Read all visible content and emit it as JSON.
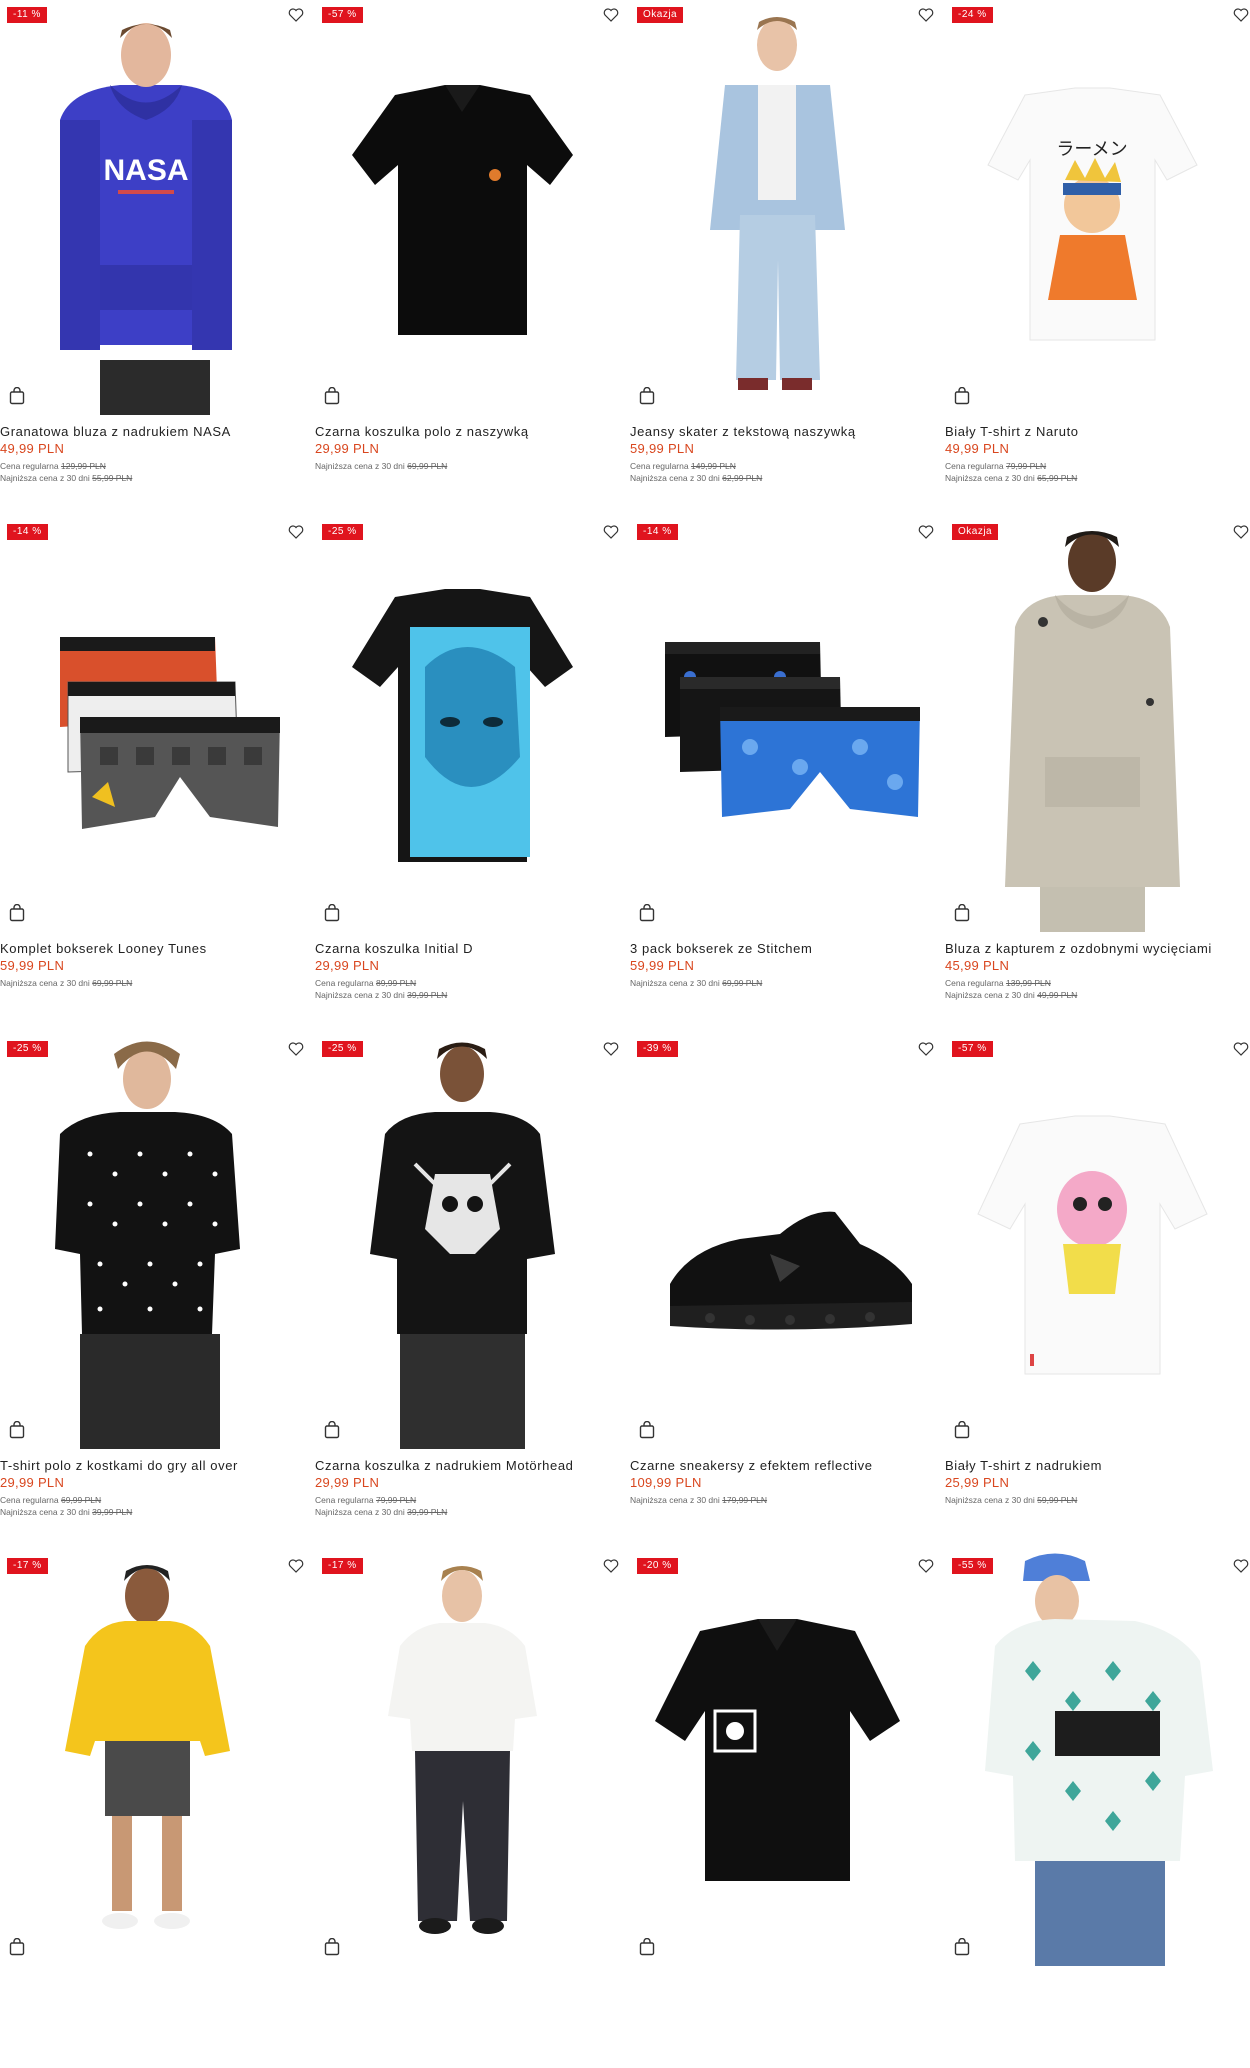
{
  "colors": {
    "badge": "#e0141e",
    "price": "#d9471f",
    "text": "#222222",
    "meta": "#666666"
  },
  "products": [
    {
      "badge": "-11 %",
      "title": "Granatowa bluza z nadrukiem NASA",
      "price": "49,99 PLN",
      "regular_label": "Cena regularna",
      "regular_price": "129,99 PLN",
      "lowest_label": "Najniższa cena z 30 dni",
      "lowest_price": "55,99 PLN",
      "image": "hoodie-nasa-model"
    },
    {
      "badge": "-57 %",
      "title": "Czarna koszulka polo z naszywką",
      "price": "29,99 PLN",
      "regular_label": "",
      "regular_price": "",
      "lowest_label": "Najniższa cena z 30 dni",
      "lowest_price": "69,99 PLN",
      "image": "black-polo"
    },
    {
      "badge": "Okazja",
      "title": "Jeansy skater z tekstową naszywką",
      "price": "59,99 PLN",
      "regular_label": "Cena regularna",
      "regular_price": "149,99 PLN",
      "lowest_label": "Najniższa cena z 30 dni",
      "lowest_price": "62,99 PLN",
      "image": "denim-set-model"
    },
    {
      "badge": "-24 %",
      "title": "Biały T-shirt z Naruto",
      "price": "49,99 PLN",
      "regular_label": "Cena regularna",
      "regular_price": "79,99 PLN",
      "lowest_label": "Najniższa cena z 30 dni",
      "lowest_price": "65,99 PLN",
      "image": "white-tee-naruto"
    },
    {
      "badge": "-14 %",
      "title": "Komplet bokserek Looney Tunes",
      "price": "59,99 PLN",
      "regular_label": "",
      "regular_price": "",
      "lowest_label": "Najniższa cena z 30 dni",
      "lowest_price": "69,99 PLN",
      "image": "boxers-looney"
    },
    {
      "badge": "-25 %",
      "title": "Czarna koszulka Initial D",
      "price": "29,99 PLN",
      "regular_label": "Cena regularna",
      "regular_price": "89,99 PLN",
      "lowest_label": "Najniższa cena z 30 dni",
      "lowest_price": "39,99 PLN",
      "image": "black-tee-initiald"
    },
    {
      "badge": "-14 %",
      "title": "3 pack bokserek ze Stitchem",
      "price": "59,99 PLN",
      "regular_label": "",
      "regular_price": "",
      "lowest_label": "Najniższa cena z 30 dni",
      "lowest_price": "69,99 PLN",
      "image": "boxers-stitch"
    },
    {
      "badge": "Okazja",
      "title": "Bluza z kapturem z ozdobnymi wycięciami",
      "price": "45,99 PLN",
      "regular_label": "Cena regularna",
      "regular_price": "139,99 PLN",
      "lowest_label": "Najniższa cena z 30 dni",
      "lowest_price": "49,99 PLN",
      "image": "beige-hoodie-model"
    },
    {
      "badge": "-25 %",
      "title": "T-shirt polo z kostkami do gry all over",
      "price": "29,99 PLN",
      "regular_label": "Cena regularna",
      "regular_price": "69,99 PLN",
      "lowest_label": "Najniższa cena z 30 dni",
      "lowest_price": "39,99 PLN",
      "image": "polo-dice-model"
    },
    {
      "badge": "-25 %",
      "title": "Czarna koszulka z nadrukiem Motörhead",
      "price": "29,99 PLN",
      "regular_label": "Cena regularna",
      "regular_price": "79,99 PLN",
      "lowest_label": "Najniższa cena z 30 dni",
      "lowest_price": "39,99 PLN",
      "image": "motorhead-tee-model"
    },
    {
      "badge": "-39 %",
      "title": "Czarne sneakersy z efektem reflective",
      "price": "109,99 PLN",
      "regular_label": "",
      "regular_price": "",
      "lowest_label": "Najniższa cena z 30 dni",
      "lowest_price": "179,99 PLN",
      "image": "black-sneaker"
    },
    {
      "badge": "-57 %",
      "title": "Biały T-shirt z nadrukiem",
      "price": "25,99 PLN",
      "regular_label": "",
      "regular_price": "",
      "lowest_label": "Najniższa cena z 30 dni",
      "lowest_price": "59,99 PLN",
      "image": "white-tee-skull"
    },
    {
      "badge": "-17 %",
      "title": "",
      "price": "",
      "regular_label": "",
      "regular_price": "",
      "lowest_label": "",
      "lowest_price": "",
      "image": "yellow-jacket-model"
    },
    {
      "badge": "-17 %",
      "title": "",
      "price": "",
      "regular_label": "",
      "regular_price": "",
      "lowest_label": "",
      "lowest_price": "",
      "image": "white-tee-model"
    },
    {
      "badge": "-20 %",
      "title": "",
      "price": "",
      "regular_label": "",
      "regular_price": "",
      "lowest_label": "",
      "lowest_price": "",
      "image": "black-polo-print"
    },
    {
      "badge": "-55 %",
      "title": "",
      "price": "",
      "regular_label": "",
      "regular_price": "",
      "lowest_label": "",
      "lowest_price": "",
      "image": "pattern-tee-model"
    }
  ]
}
